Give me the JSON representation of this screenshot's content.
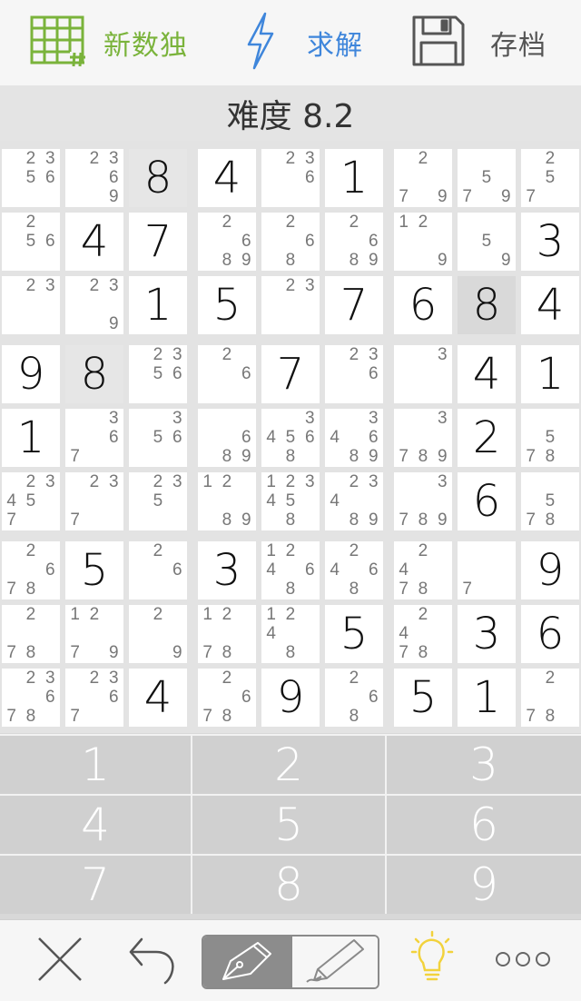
{
  "toolbar": {
    "new_label": "新数独",
    "solve_label": "求解",
    "save_label": "存档",
    "new_icon": "grid-icon",
    "solve_icon": "lightning-icon",
    "save_icon": "floppy-disk-icon",
    "new_color": "#7ab33b",
    "solve_color": "#3f86db"
  },
  "difficulty": {
    "label": "难度 8.2"
  },
  "grid": {
    "rows": [
      [
        {
          "c": [
            2,
            3,
            5,
            6
          ]
        },
        {
          "c": [
            2,
            3,
            6,
            9
          ]
        },
        {
          "v": "8",
          "h": 1
        },
        {
          "v": "4"
        },
        {
          "c": [
            2,
            3,
            6
          ]
        },
        {
          "v": "1"
        },
        {
          "c": [
            2,
            7,
            9
          ]
        },
        {
          "c": [
            5,
            7,
            9
          ]
        },
        {
          "c": [
            2,
            5,
            7
          ]
        }
      ],
      [
        {
          "c": [
            2,
            5,
            6
          ]
        },
        {
          "v": "4"
        },
        {
          "v": "7"
        },
        {
          "c": [
            2,
            6,
            8,
            9
          ]
        },
        {
          "c": [
            2,
            6,
            8
          ]
        },
        {
          "c": [
            2,
            6,
            8,
            9
          ]
        },
        {
          "c": [
            1,
            2,
            9
          ]
        },
        {
          "c": [
            5,
            9
          ]
        },
        {
          "v": "3"
        }
      ],
      [
        {
          "c": [
            2,
            3
          ]
        },
        {
          "c": [
            2,
            3,
            9
          ]
        },
        {
          "v": "1"
        },
        {
          "v": "5"
        },
        {
          "c": [
            2,
            3
          ]
        },
        {
          "v": "7"
        },
        {
          "v": "6"
        },
        {
          "v": "8",
          "h": 2
        },
        {
          "v": "4"
        }
      ],
      [
        {
          "v": "9"
        },
        {
          "v": "8",
          "h": 1
        },
        {
          "c": [
            2,
            3,
            5,
            6
          ]
        },
        {
          "c": [
            2,
            6
          ]
        },
        {
          "v": "7"
        },
        {
          "c": [
            2,
            3,
            6
          ]
        },
        {
          "c": [
            3
          ]
        },
        {
          "v": "4"
        },
        {
          "v": "1"
        }
      ],
      [
        {
          "v": "1"
        },
        {
          "c": [
            3,
            6,
            7
          ]
        },
        {
          "c": [
            3,
            5,
            6
          ]
        },
        {
          "c": [
            6,
            8,
            9
          ]
        },
        {
          "c": [
            3,
            4,
            5,
            6,
            8
          ]
        },
        {
          "c": [
            3,
            4,
            6,
            8,
            9
          ]
        },
        {
          "c": [
            3,
            7,
            8,
            9
          ]
        },
        {
          "v": "2"
        },
        {
          "c": [
            5,
            7,
            8
          ]
        }
      ],
      [
        {
          "c": [
            2,
            3,
            4,
            5,
            7
          ]
        },
        {
          "c": [
            2,
            3,
            7
          ]
        },
        {
          "c": [
            2,
            3,
            5
          ]
        },
        {
          "c": [
            1,
            2,
            8,
            9
          ]
        },
        {
          "c": [
            1,
            2,
            3,
            4,
            5,
            8
          ]
        },
        {
          "c": [
            2,
            3,
            4,
            8,
            9
          ]
        },
        {
          "c": [
            3,
            7,
            8,
            9
          ]
        },
        {
          "v": "6"
        },
        {
          "c": [
            5,
            7,
            8
          ]
        }
      ],
      [
        {
          "c": [
            2,
            6,
            7,
            8
          ]
        },
        {
          "v": "5"
        },
        {
          "c": [
            2,
            6
          ]
        },
        {
          "v": "3"
        },
        {
          "c": [
            1,
            2,
            4,
            6,
            8
          ]
        },
        {
          "c": [
            2,
            4,
            6,
            8
          ]
        },
        {
          "c": [
            2,
            4,
            7,
            8
          ]
        },
        {
          "c": [
            7
          ]
        },
        {
          "v": "9"
        }
      ],
      [
        {
          "c": [
            2,
            7,
            8
          ]
        },
        {
          "c": [
            1,
            2,
            7,
            9
          ]
        },
        {
          "c": [
            2,
            9
          ]
        },
        {
          "c": [
            1,
            2,
            7,
            8
          ]
        },
        {
          "c": [
            1,
            2,
            4,
            8
          ]
        },
        {
          "v": "5"
        },
        {
          "c": [
            2,
            4,
            7,
            8
          ]
        },
        {
          "v": "3"
        },
        {
          "v": "6"
        }
      ],
      [
        {
          "c": [
            2,
            3,
            6,
            7,
            8
          ]
        },
        {
          "c": [
            2,
            3,
            6,
            7
          ]
        },
        {
          "v": "4"
        },
        {
          "c": [
            2,
            6,
            7,
            8
          ]
        },
        {
          "v": "9"
        },
        {
          "c": [
            2,
            6,
            8
          ]
        },
        {
          "v": "5"
        },
        {
          "v": "1"
        },
        {
          "c": [
            2,
            7,
            8
          ]
        }
      ]
    ]
  },
  "keypad": {
    "keys": [
      "1",
      "2",
      "3",
      "4",
      "5",
      "6",
      "7",
      "8",
      "9"
    ]
  },
  "bottombar": {
    "clear_icon": "close-icon",
    "undo_icon": "undo-icon",
    "pen_icon": "pen-icon",
    "pencil_icon": "pencil-icon",
    "hint_icon": "lightbulb-icon",
    "more_icon": "more-icon",
    "hint_color": "#f2d23c"
  }
}
